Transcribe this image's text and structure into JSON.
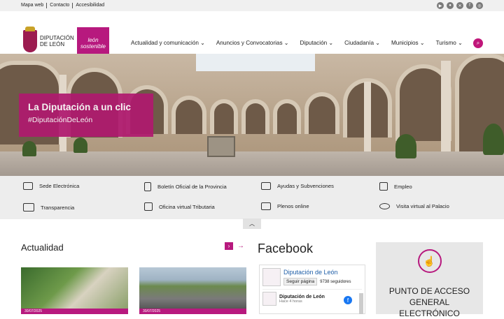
{
  "topbar": {
    "links": [
      "Mapa web",
      "Contacto",
      "Accesibilidad"
    ],
    "social_icons": [
      "youtube-icon",
      "flickr-icon",
      "x-icon",
      "facebook-icon",
      "instagram-icon"
    ]
  },
  "header": {
    "logo_text_line1": "DIPUTACIÓN",
    "logo_text_line2": "DE LEÓN",
    "logo2_line1": "león",
    "logo2_line2": "sostenible",
    "nav": [
      "Actualidad y comunicación",
      "Anuncios y Convocatorias",
      "Diputación",
      "Ciudadanía",
      "Municipios",
      "Turismo"
    ],
    "search_icon": "search-icon",
    "accent": "#b7197e"
  },
  "hero": {
    "title": "La Diputación a un clic",
    "hashtag": "#DiputaciónDeLeón"
  },
  "quick_links": [
    {
      "label": "Sede Electrónica",
      "icon": "hand-pointer-icon"
    },
    {
      "label": "Boletín Oficial de la Provincia",
      "icon": "document-icon"
    },
    {
      "label": "Ayudas y Subvenciones",
      "icon": "hand-coins-icon"
    },
    {
      "label": "Empleo",
      "icon": "badge-icon"
    },
    {
      "label": "Transparencia",
      "icon": "windows-icon"
    },
    {
      "label": "Oficina virtual Tributaria",
      "icon": "calculator-icon"
    },
    {
      "label": "Plenos online",
      "icon": "video-icon"
    },
    {
      "label": "Visita virtual al Palacio",
      "icon": "eye-icon"
    }
  ],
  "actualidad": {
    "title": "Actualidad",
    "news": [
      {
        "date": "30/07/2025"
      },
      {
        "date": "30/07/2025"
      }
    ]
  },
  "facebook": {
    "title": "Facebook",
    "page_name": "Diputación de León",
    "follow_label": "Seguir página",
    "followers": "9738 seguidores",
    "post_name": "Diputación de León",
    "post_time": "Hace 4 horas"
  },
  "access_card": {
    "line1": "PUNTO DE ACCESO",
    "line2": "GENERAL",
    "line3": "ELECTRÓNICO"
  }
}
